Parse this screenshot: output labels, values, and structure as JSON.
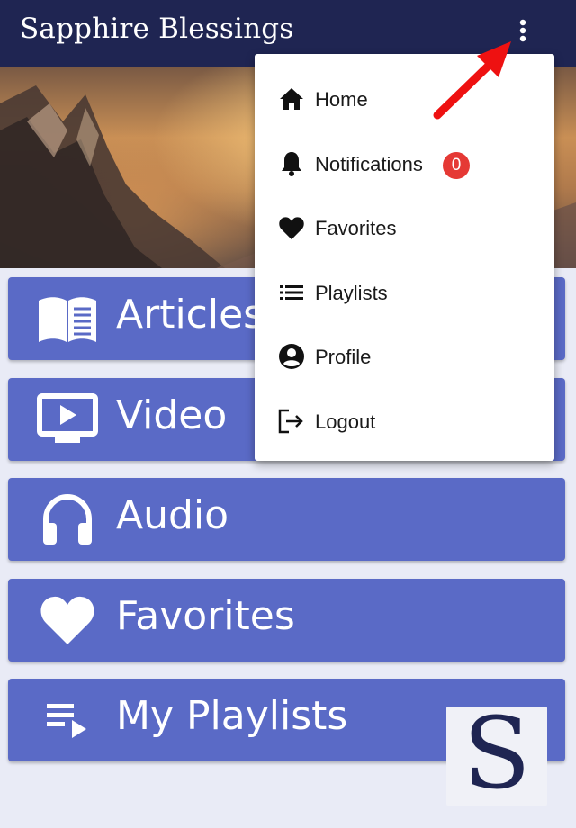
{
  "appbar": {
    "title": "Sapphire Blessings",
    "more_icon": "more-vert-icon",
    "color": "#1f2552"
  },
  "menu": {
    "accent": "#5a6ac6",
    "items": [
      {
        "label": "Articles",
        "icon": "book-icon"
      },
      {
        "label": "Video",
        "icon": "video-tv-icon"
      },
      {
        "label": "Audio",
        "icon": "headphones-icon"
      },
      {
        "label": "Favorites",
        "icon": "heart-icon"
      },
      {
        "label": "My Playlists",
        "icon": "playlist-play-icon"
      }
    ]
  },
  "logo": {
    "letter": "S"
  },
  "dropdown": {
    "items": [
      {
        "label": "Home",
        "icon": "home-icon"
      },
      {
        "label": "Notifications",
        "icon": "bell-icon",
        "badge": "0"
      },
      {
        "label": "Favorites",
        "icon": "heart-icon"
      },
      {
        "label": "Playlists",
        "icon": "list-icon"
      },
      {
        "label": "Profile",
        "icon": "account-circle-icon"
      },
      {
        "label": "Logout",
        "icon": "logout-icon"
      }
    ],
    "badge_color": "#e53935"
  },
  "annotation": {
    "arrow_color": "#ee1111"
  }
}
